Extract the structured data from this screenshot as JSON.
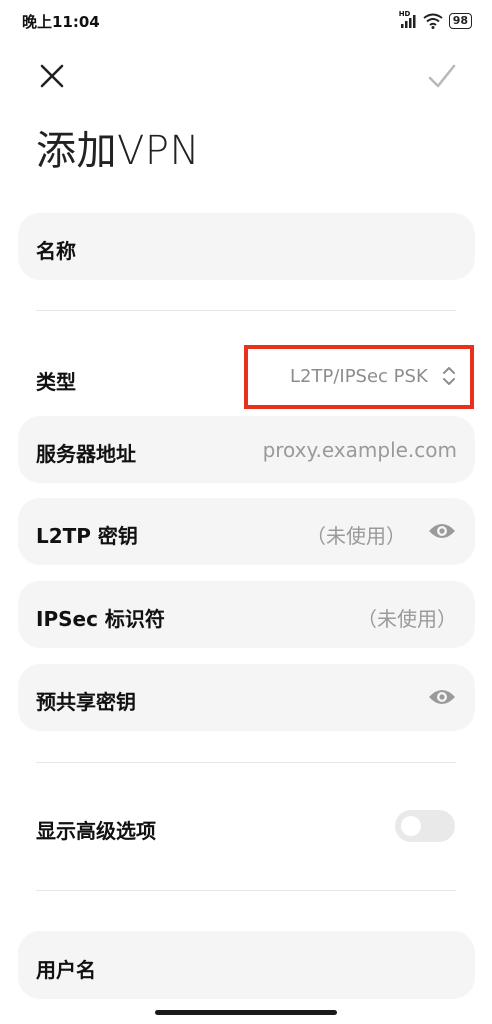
{
  "status_bar": {
    "time": "晚上11:04",
    "network_label": "HD",
    "battery": "98"
  },
  "header": {
    "title": "添加VPN"
  },
  "form": {
    "name_label": "名称",
    "type_label": "类型",
    "type_value": "L2TP/IPSec PSK",
    "server_label": "服务器地址",
    "server_placeholder": "proxy.example.com",
    "l2tp_label": "L2TP 密钥",
    "l2tp_value": "（未使用）",
    "ipsec_id_label": "IPSec 标识符",
    "ipsec_id_value": "（未使用）",
    "psk_label": "预共享密钥",
    "advanced_label": "显示高级选项",
    "advanced_enabled": false,
    "username_label": "用户名"
  },
  "icons": {
    "close": "close-icon",
    "confirm": "check-icon",
    "eye": "eye-icon",
    "dropdown": "chevron-updown-icon"
  },
  "colors": {
    "highlight": "#e8311d",
    "card_bg": "#f5f5f5",
    "muted_text": "#9a9a9a"
  }
}
